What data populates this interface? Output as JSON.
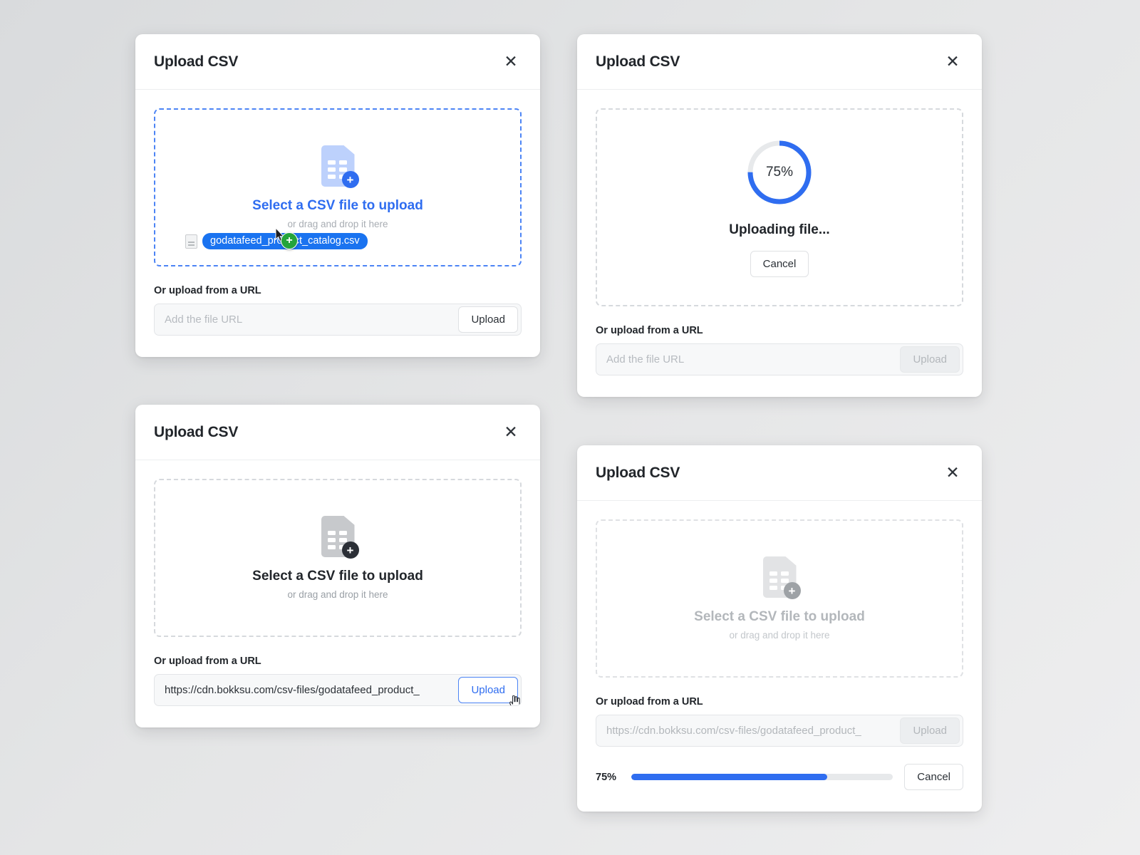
{
  "colors": {
    "accent": "#2f6df0",
    "accent_dash": "#4c84f5",
    "chip_blue": "#1a73f0",
    "plus_green": "#24a43b",
    "track_grey": "#e7e9eb",
    "text_dark": "#22262b",
    "text_muted": "#9aa0a6",
    "disabled_text": "#b3b7bb"
  },
  "dialogs": {
    "drag": {
      "title": "Upload CSV",
      "close_icon": "close-icon",
      "dropzone": {
        "icon": "csv-file-add-icon",
        "title": "Select a CSV file to upload",
        "subtitle": "or drag and drop it here",
        "state": "active"
      },
      "drag_chip": {
        "filename": "godatafeed_product_catalog.csv",
        "badge_icon": "plus-badge-icon",
        "cursor_icon": "arrow-cursor-icon",
        "thumb_icon": "file-thumbnail-icon"
      },
      "url": {
        "label": "Or upload from a URL",
        "value": "",
        "placeholder": "Add the file URL",
        "button": "Upload",
        "button_state": "enabled"
      }
    },
    "uploading": {
      "title": "Upload CSV",
      "close_icon": "close-icon",
      "progress": {
        "percent_label": "75%",
        "percent_value": 75,
        "status": "Uploading file...",
        "cancel_button": "Cancel"
      },
      "url": {
        "label": "Or upload from a URL",
        "value": "",
        "placeholder": "Add the file URL",
        "button": "Upload",
        "button_state": "disabled"
      }
    },
    "url_entered": {
      "title": "Upload CSV",
      "close_icon": "close-icon",
      "dropzone": {
        "icon": "csv-file-add-icon",
        "title": "Select a CSV file to upload",
        "subtitle": "or drag and drop it here",
        "state": "idle"
      },
      "url": {
        "label": "Or upload from a URL",
        "value": "https://cdn.bokksu.com/csv-files/godatafeed_product_",
        "placeholder": "Add the file URL",
        "button": "Upload",
        "button_state": "focused",
        "cursor_icon": "pointer-hand-cursor-icon"
      }
    },
    "url_uploading": {
      "title": "Upload CSV",
      "close_icon": "close-icon",
      "dropzone": {
        "icon": "csv-file-add-icon",
        "title": "Select a CSV file to upload",
        "subtitle": "or drag and drop it here",
        "state": "dimmed"
      },
      "url": {
        "label": "Or upload from a URL",
        "value": "https://cdn.bokksu.com/csv-files/godatafeed_product_",
        "placeholder": "Add the file URL",
        "button": "Upload",
        "button_state": "disabled"
      },
      "progress": {
        "percent_label": "75%",
        "percent_value": 75,
        "cancel_button": "Cancel"
      }
    }
  }
}
